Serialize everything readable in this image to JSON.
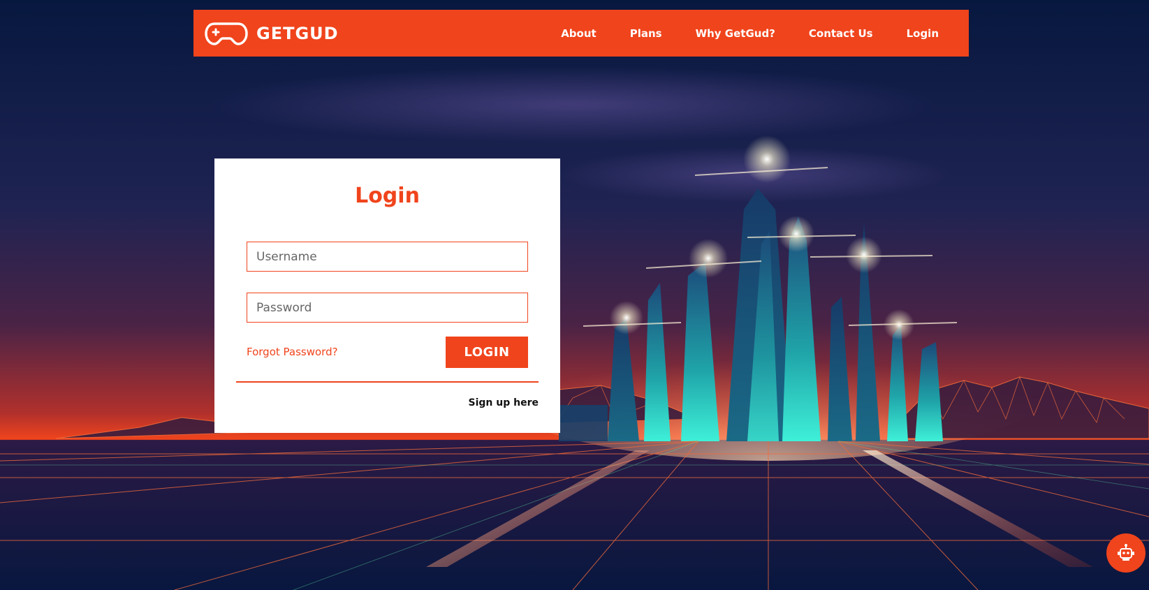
{
  "brand": {
    "name": "GETGUD",
    "accent_color": "#f0441c",
    "logo_icon": "gamepad-icon"
  },
  "nav": {
    "items": [
      {
        "label": "About"
      },
      {
        "label": "Plans"
      },
      {
        "label": "Why GetGud?"
      },
      {
        "label": "Contact Us"
      },
      {
        "label": "Login"
      }
    ]
  },
  "login": {
    "title": "Login",
    "username_placeholder": "Username",
    "password_placeholder": "Password",
    "forgot_label": "Forgot Password?",
    "submit_label": "LOGIN",
    "signup_label": "Sign up here"
  },
  "chat": {
    "icon": "robot-icon"
  }
}
